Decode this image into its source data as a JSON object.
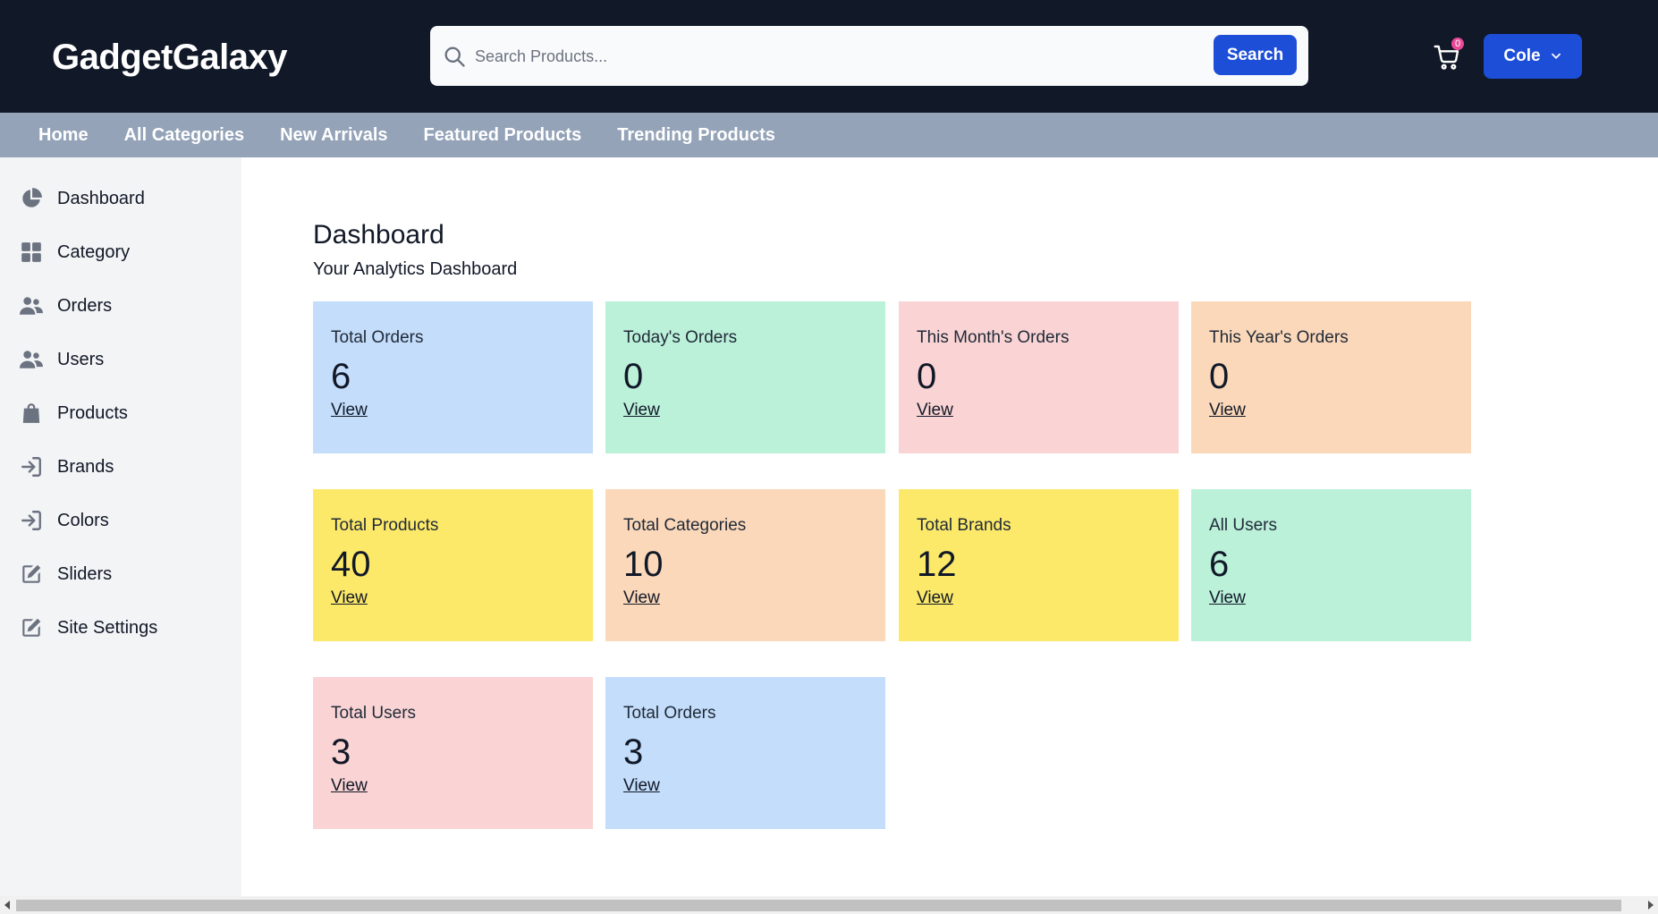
{
  "header": {
    "logo": "GadgetGalaxy",
    "search_placeholder": "Search Products...",
    "search_button": "Search",
    "cart_count": "0",
    "user_name": "Cole"
  },
  "nav": {
    "links": [
      "Home",
      "All Categories",
      "New Arrivals",
      "Featured Products",
      "Trending Products"
    ]
  },
  "sidebar": {
    "items": [
      {
        "label": "Dashboard",
        "icon": "pie-chart-icon"
      },
      {
        "label": "Category",
        "icon": "grid-icon"
      },
      {
        "label": "Orders",
        "icon": "users-icon"
      },
      {
        "label": "Users",
        "icon": "users-icon"
      },
      {
        "label": "Products",
        "icon": "shopping-bag-icon"
      },
      {
        "label": "Brands",
        "icon": "sign-in-icon"
      },
      {
        "label": "Colors",
        "icon": "sign-in-icon"
      },
      {
        "label": "Sliders",
        "icon": "edit-icon"
      },
      {
        "label": "Site Settings",
        "icon": "edit-icon"
      }
    ]
  },
  "main": {
    "title": "Dashboard",
    "subtitle": "Your Analytics Dashboard",
    "cards": [
      {
        "label": "Total Orders",
        "value": "6",
        "link": "View",
        "color": "#c3ddfa"
      },
      {
        "label": "Today's Orders",
        "value": "0",
        "link": "View",
        "color": "#bbf0d9"
      },
      {
        "label": "This Month's Orders",
        "value": "0",
        "link": "View",
        "color": "#fad4d4"
      },
      {
        "label": "This Year's Orders",
        "value": "0",
        "link": "View",
        "color": "#fbd8b9"
      },
      {
        "label": "Total Products",
        "value": "40",
        "link": "View",
        "color": "#fce96a"
      },
      {
        "label": "Total Categories",
        "value": "10",
        "link": "View",
        "color": "#fbd8b9"
      },
      {
        "label": "Total Brands",
        "value": "12",
        "link": "View",
        "color": "#fce96a"
      },
      {
        "label": "All Users",
        "value": "6",
        "link": "View",
        "color": "#bbf0d9"
      },
      {
        "label": "Total Users",
        "value": "3",
        "link": "View",
        "color": "#fad4d4"
      },
      {
        "label": "Total Orders",
        "value": "3",
        "link": "View",
        "color": "#c3ddfa"
      }
    ]
  },
  "colors": {
    "header_bg": "#111827",
    "nav_bg": "#94a3b8",
    "sidebar_bg": "#f3f4f6",
    "accent": "#1d4ed8",
    "badge": "#ec4899"
  }
}
